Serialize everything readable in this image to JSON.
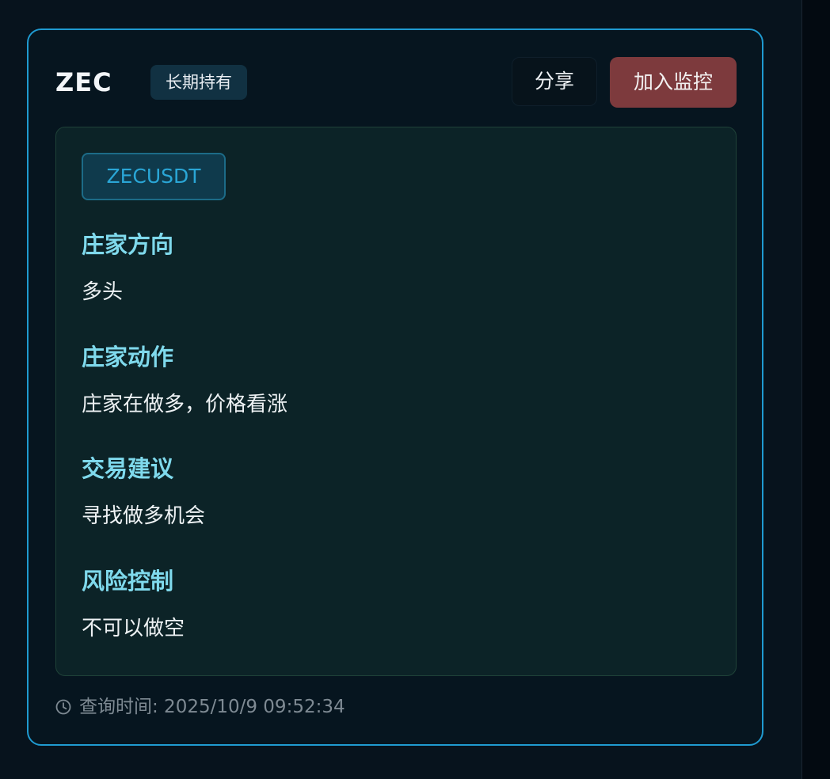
{
  "card": {
    "symbol": "ZEC",
    "tag": "长期持有",
    "share_label": "分享",
    "monitor_label": "加入监控",
    "pair": "ZECUSDT",
    "sections": [
      {
        "title": "庄家方向",
        "value": "多头"
      },
      {
        "title": "庄家动作",
        "value": "庄家在做多，价格看涨"
      },
      {
        "title": "交易建议",
        "value": "寻找做多机会"
      },
      {
        "title": "风险控制",
        "value": "不可以做空"
      }
    ],
    "query_time_label": "查询时间: 2025/10/9 09:52:34",
    "icons": {
      "clock": "clock-icon"
    }
  },
  "colors": {
    "accent": "#1f9ad0",
    "danger": "#7d3a3d",
    "heading": "#7fd9ec"
  }
}
